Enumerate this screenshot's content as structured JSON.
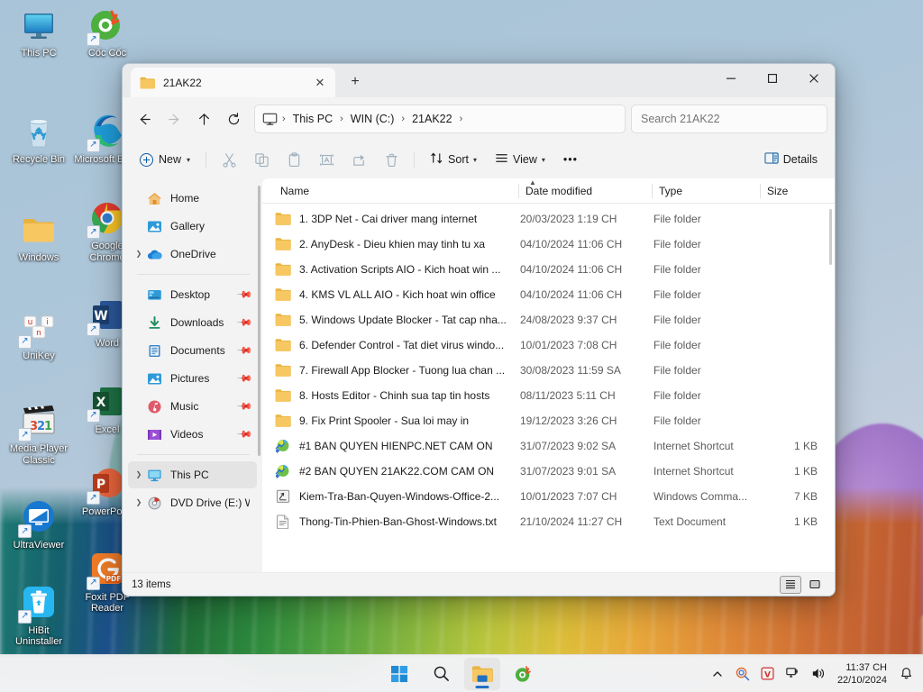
{
  "desktop": {
    "icons": [
      {
        "label": "This PC",
        "icon": "this-pc-icon",
        "shortcut": false
      },
      {
        "label": "Recycle Bin",
        "icon": "recycle-bin-icon",
        "shortcut": false
      },
      {
        "label": "Windows",
        "icon": "folder-icon",
        "shortcut": false
      },
      {
        "label": "UniKey",
        "icon": "unikey-icon",
        "shortcut": true
      },
      {
        "label": "Media Player Classic",
        "icon": "media-player-classic-icon",
        "shortcut": true
      },
      {
        "label": "UltraViewer",
        "icon": "ultraviewer-icon",
        "shortcut": true
      },
      {
        "label": "HiBit Uninstaller",
        "icon": "hibit-uninstaller-icon",
        "shortcut": true
      },
      {
        "label": "Cốc Cốc",
        "icon": "coccoc-icon",
        "shortcut": true
      },
      {
        "label": "Microsoft Edge",
        "icon": "edge-icon",
        "shortcut": true
      },
      {
        "label": "Google Chrome",
        "icon": "chrome-icon",
        "shortcut": true
      },
      {
        "label": "Word",
        "icon": "word-icon",
        "shortcut": true
      },
      {
        "label": "Excel",
        "icon": "excel-icon",
        "shortcut": true
      },
      {
        "label": "PowerPoint",
        "icon": "powerpoint-icon",
        "shortcut": true
      },
      {
        "label": "Foxit PDF Reader",
        "icon": "foxit-pdf-reader-icon",
        "shortcut": true
      }
    ]
  },
  "window": {
    "tab": {
      "title": "21AK22",
      "icon": "folder-icon",
      "close_label": "✕"
    },
    "new_tab_label": "+",
    "controls": {
      "minimize": "—",
      "maximize": "☐",
      "close": "✕"
    }
  },
  "nav": {
    "back": "←",
    "forward": "→",
    "up": "↑",
    "refresh": "⟳",
    "breadcrumbs": [
      "This PC",
      "WIN (C:)",
      "21AK22"
    ],
    "separator": "›"
  },
  "search": {
    "placeholder": "Search 21AK22",
    "value": ""
  },
  "toolbar": {
    "new_label": "New",
    "cut_label": "Cut",
    "copy_label": "Copy",
    "paste_label": "Paste",
    "rename_label": "Rename",
    "share_label": "Share",
    "delete_label": "Delete",
    "sort_label": "Sort",
    "view_label": "View",
    "more_label": "•••",
    "details_label": "Details"
  },
  "sidebar": {
    "items": [
      {
        "label": "Home",
        "icon": "home-icon",
        "twisty": false,
        "pinned": false,
        "selected": false
      },
      {
        "label": "Gallery",
        "icon": "gallery-icon",
        "twisty": false,
        "pinned": false,
        "selected": false
      },
      {
        "label": "OneDrive",
        "icon": "onedrive-icon",
        "twisty": true,
        "pinned": false,
        "selected": false
      },
      {
        "label": "Desktop",
        "icon": "desktop-icon",
        "twisty": false,
        "pinned": true,
        "selected": false
      },
      {
        "label": "Downloads",
        "icon": "downloads-icon",
        "twisty": false,
        "pinned": true,
        "selected": false
      },
      {
        "label": "Documents",
        "icon": "documents-icon",
        "twisty": false,
        "pinned": true,
        "selected": false
      },
      {
        "label": "Pictures",
        "icon": "pictures-icon",
        "twisty": false,
        "pinned": true,
        "selected": false
      },
      {
        "label": "Music",
        "icon": "music-icon",
        "twisty": false,
        "pinned": true,
        "selected": false
      },
      {
        "label": "Videos",
        "icon": "videos-icon",
        "twisty": false,
        "pinned": true,
        "selected": false
      },
      {
        "label": "This PC",
        "icon": "this-pc-icon",
        "twisty": true,
        "pinned": false,
        "selected": true
      },
      {
        "label": "DVD Drive (E:) W",
        "icon": "dvd-drive-icon",
        "twisty": true,
        "pinned": false,
        "selected": false
      }
    ]
  },
  "filelist": {
    "columns": [
      "Name",
      "Date modified",
      "Type",
      "Size"
    ],
    "sort_caret": "▲",
    "rows": [
      {
        "name": "1. 3DP Net - Cai driver mang internet",
        "date": "20/03/2023 1:19 CH",
        "type": "File folder",
        "size": "",
        "icon": "folder-icon"
      },
      {
        "name": "2. AnyDesk - Dieu khien may tinh tu xa",
        "date": "04/10/2024 11:06 CH",
        "type": "File folder",
        "size": "",
        "icon": "folder-icon"
      },
      {
        "name": "3. Activation Scripts AIO - Kich hoat win ...",
        "date": "04/10/2024 11:06 CH",
        "type": "File folder",
        "size": "",
        "icon": "folder-icon"
      },
      {
        "name": "4. KMS VL ALL AIO - Kich hoat win office",
        "date": "04/10/2024 11:06 CH",
        "type": "File folder",
        "size": "",
        "icon": "folder-icon"
      },
      {
        "name": "5. Windows Update Blocker - Tat cap nha...",
        "date": "24/08/2023 9:37 CH",
        "type": "File folder",
        "size": "",
        "icon": "folder-icon"
      },
      {
        "name": "6. Defender Control - Tat diet virus windo...",
        "date": "10/01/2023 7:08 CH",
        "type": "File folder",
        "size": "",
        "icon": "folder-icon"
      },
      {
        "name": "7. Firewall App Blocker - Tuong lua chan ...",
        "date": "30/08/2023 11:59 SA",
        "type": "File folder",
        "size": "",
        "icon": "folder-icon"
      },
      {
        "name": "8. Hosts Editor - Chinh sua tap tin hosts",
        "date": "08/11/2023 5:11 CH",
        "type": "File folder",
        "size": "",
        "icon": "folder-icon"
      },
      {
        "name": "9. Fix Print Spooler - Sua loi may in",
        "date": "19/12/2023 3:26 CH",
        "type": "File folder",
        "size": "",
        "icon": "folder-icon"
      },
      {
        "name": "#1 BAN QUYEN HIENPC.NET CAM ON",
        "date": "31/07/2023 9:02 SA",
        "type": "Internet Shortcut",
        "size": "1 KB",
        "icon": "internet-shortcut-icon"
      },
      {
        "name": "#2 BAN QUYEN 21AK22.COM CAM ON",
        "date": "31/07/2023 9:01 SA",
        "type": "Internet Shortcut",
        "size": "1 KB",
        "icon": "internet-shortcut-icon"
      },
      {
        "name": "Kiem-Tra-Ban-Quyen-Windows-Office-2...",
        "date": "10/01/2023 7:07 CH",
        "type": "Windows Comma...",
        "size": "7 KB",
        "icon": "windows-command-script-icon"
      },
      {
        "name": "Thong-Tin-Phien-Ban-Ghost-Windows.txt",
        "date": "21/10/2024 11:27 CH",
        "type": "Text Document",
        "size": "1 KB",
        "icon": "text-document-icon"
      }
    ]
  },
  "statusbar": {
    "item_count": "13 items",
    "details_view_label": "Details view",
    "large_icons_view_label": "Large icons view"
  },
  "taskbar": {
    "start_label": "Start",
    "search_label": "Search",
    "file_explorer_label": "File Explorer",
    "coccoc_label": "Cốc Cốc",
    "tray": {
      "overflow": "⌃",
      "items": [
        "search-tray-icon",
        "unikey-tray-icon",
        "network-icon",
        "volume-icon"
      ],
      "time": "11:37 CH",
      "date": "22/10/2024",
      "notification": "notification-bell-icon"
    }
  },
  "colors": {
    "accent": "#0a5ca8",
    "folder": "#f7c761",
    "taskbar_indicator": "#1f6fc4"
  }
}
